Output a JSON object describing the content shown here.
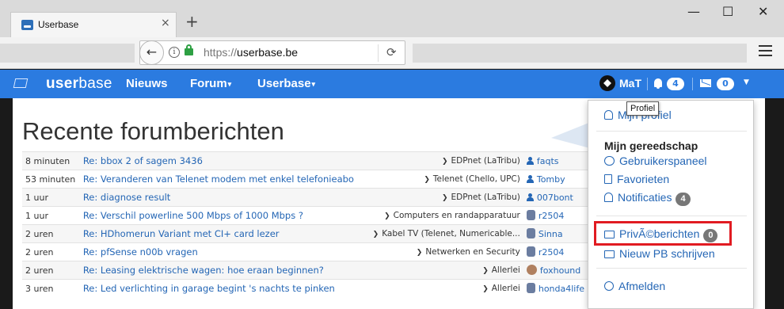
{
  "browser": {
    "tab_title": "Userbase",
    "tab_close": "×",
    "new_tab": "+",
    "window_controls": [
      "—",
      "☐",
      "✕"
    ],
    "back": "←",
    "info": "i",
    "url_prefix": "https://",
    "url_host": "userbase.be",
    "reload": "⟳",
    "icons": {
      "back": "back-arrow-icon",
      "info": "info-icon",
      "lock": "lock-icon",
      "reload": "reload-icon",
      "menu": "hamburger-menu-icon"
    }
  },
  "site": {
    "logo_prefix": "user",
    "logo_suffix": "base",
    "nav": [
      {
        "label": "Nieuws",
        "caret": ""
      },
      {
        "label": "Forum",
        "caret": "▾"
      },
      {
        "label": "Userbase",
        "caret": "▾"
      }
    ],
    "user_name": "MaT",
    "notifications_count": "4",
    "messages_count": "0",
    "caret": "▼",
    "colors": {
      "header": "#2b7be0",
      "link": "#2466b5",
      "highlight": "#e11b22"
    }
  },
  "page": {
    "title": "Recente forumberichten",
    "posts": [
      {
        "time": "8 minuten",
        "subject": "Re: bbox 2 of sagem 3436",
        "forum": "EDPnet (LaTribu)",
        "user": "faqts",
        "avatar": "person"
      },
      {
        "time": "53 minuten",
        "subject": "Re: Veranderen van Telenet modem met enkel telefonieabo",
        "forum": "Telenet (Chello, UPC)",
        "user": "Tomby",
        "avatar": "person"
      },
      {
        "time": "1 uur",
        "subject": "Re: diagnose result",
        "forum": "EDPnet (LaTribu)",
        "user": "007bont",
        "avatar": "person"
      },
      {
        "time": "1 uur",
        "subject": "Re: Verschil powerline 500 Mbps of 1000 Mbps ?",
        "forum": "Computers en randapparatuur",
        "user": "r2504",
        "avatar": "robot"
      },
      {
        "time": "2 uren",
        "subject": "Re: HDhomerun Variant met CI+ card lezer",
        "forum": "Kabel TV (Telenet, Numericable...",
        "user": "Sinna",
        "avatar": "robot"
      },
      {
        "time": "2 uren",
        "subject": "Re: pfSense n00b vragen",
        "forum": "Netwerken en Security",
        "user": "r2504",
        "avatar": "robot"
      },
      {
        "time": "2 uren",
        "subject": "Re: Leasing elektrische wagen: hoe eraan beginnen?",
        "forum": "Allerlei",
        "user": "foxhound",
        "avatar": "photo"
      },
      {
        "time": "3 uren",
        "subject": "Re: Led verlichting in garage begint 's nachts te pinken",
        "forum": "Allerlei",
        "user": "honda4life",
        "avatar": "robot"
      }
    ]
  },
  "dropdown": {
    "profile": "Mijn profiel",
    "tools_heading": "Mijn gereedschap",
    "control_panel": "Gebruikerspaneel",
    "favorites": "Favorieten",
    "notifications": "Notificaties",
    "notifications_count": "4",
    "private_messages": "PrivÃ©berichten",
    "private_messages_count": "0",
    "new_pm": "Nieuw PB schrijven",
    "logout": "Afmelden"
  },
  "tooltip": "Profiel"
}
